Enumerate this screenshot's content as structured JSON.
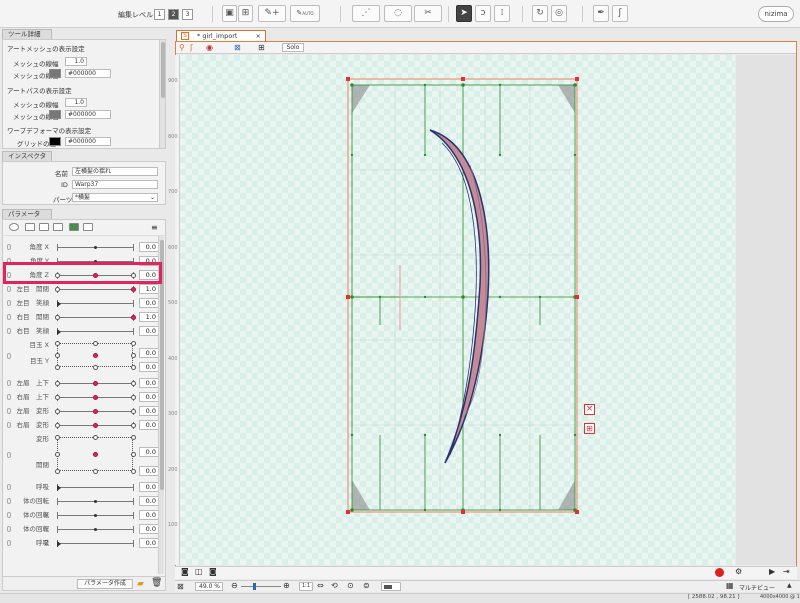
{
  "toolbar": {
    "edit_level_label": "編集レベル：",
    "levels": [
      "1",
      "2",
      "3"
    ],
    "selected_level": "2",
    "tool_labels": [
      "AUTO"
    ],
    "logo_text": "nizima",
    "icons": [
      "deformer-icon",
      "warp-icon",
      "pen-add-icon",
      "auto-mesh-icon",
      "mesh-edit-icon",
      "glue-icon",
      "mesh-cut-icon",
      "select-arrow-icon",
      "lasso-icon",
      "brush-icon",
      "rotate-icon",
      "scale-icon",
      "pen-icon",
      "hook-icon"
    ]
  },
  "tool_details": {
    "tab": "ツール詳細",
    "artmesh_header": "アートメッシュの表示設定",
    "mesh_width_label": "メッシュの線幅",
    "mesh_width_value": "1.0",
    "mesh_color_label": "メッシュの線色",
    "mesh_color_value": "#000000",
    "artpath_header": "アートパスの表示設定",
    "path_width_label": "メッシュの線幅",
    "path_width_value": "1.0",
    "path_color_label": "メッシュの線色",
    "path_color_value": "#000000",
    "warp_header": "ワープデフォーマの表示設定",
    "grid_color_label": "グリッドの色",
    "grid_color_value": "#000000"
  },
  "inspector": {
    "tab": "インスペクタ",
    "name_label": "名前",
    "name_value": "左横髪の揺れ",
    "id_label": "ID",
    "id_value": "Warp37",
    "parts_label": "パーツ",
    "parts_value": "*横髪"
  },
  "parameters": {
    "tab": "パラメータ",
    "rows": [
      {
        "name": "角度 X",
        "value": "0.0",
        "knob": 0.5,
        "style": "dot"
      },
      {
        "name": "角度 Y",
        "value": "0.0",
        "knob": 0.5,
        "style": "dot"
      },
      {
        "name": "角度 Z",
        "value": "0.0",
        "knob": 0.5,
        "style": "keys3"
      },
      {
        "name": "左目　開閉",
        "value": "1.0",
        "knob": 1.0,
        "style": "keys2"
      },
      {
        "name": "左目　笑顔",
        "value": "0.0",
        "knob": 0.0,
        "style": "tri"
      },
      {
        "name": "右目　開閉",
        "value": "1.0",
        "knob": 1.0,
        "style": "keys2"
      },
      {
        "name": "右目　笑顔",
        "value": "0.0",
        "knob": 0.0,
        "style": "tri"
      }
    ],
    "eyeball_x": {
      "name": "目玉 X",
      "value": "0.0"
    },
    "eyeball_y": {
      "name": "目玉 Y",
      "value": "0.0"
    },
    "rows2": [
      {
        "name": "左眉　上下",
        "value": "0.0",
        "knob": 0.5,
        "style": "keys3"
      },
      {
        "name": "右眉　上下",
        "value": "0.0",
        "knob": 0.5,
        "style": "keys3"
      },
      {
        "name": "左眉　変形",
        "value": "0.0",
        "knob": 0.5,
        "style": "keys3"
      },
      {
        "name": "右眉　変形",
        "value": "0.0",
        "knob": 0.5,
        "style": "keys3"
      }
    ],
    "mouth_form": {
      "name": "変形",
      "value": "0.0"
    },
    "mouth_open": {
      "name": "開閉",
      "value": "0.0"
    },
    "rows3": [
      {
        "name": "呼吸",
        "value": "0.0",
        "knob": 0.0,
        "style": "tri"
      },
      {
        "name": "体の回転　X",
        "value": "0.0",
        "knob": 0.5,
        "style": "dot"
      },
      {
        "name": "体の回転　Y",
        "value": "0.0",
        "knob": 0.5,
        "style": "dot"
      },
      {
        "name": "体の回転　Z",
        "value": "0.0",
        "knob": 0.5,
        "style": "dot"
      },
      {
        "name": "呼吸",
        "value": "0.0",
        "knob": 0.0,
        "style": "tri"
      }
    ],
    "create_button": "パラメータ作成"
  },
  "document": {
    "tab_title": "* girl_import",
    "solo_label": "Solo",
    "ruler_ticks": [
      "900",
      "800",
      "700",
      "600",
      "500",
      "400",
      "300",
      "200",
      "100"
    ]
  },
  "status": {
    "zoom": "49.0 %",
    "ratio": "1:1",
    "multiview": "マルチビュー",
    "coords": "[ 2588.02 ,   98.21 ]",
    "footer_text": "4000x4000 @ 1"
  },
  "colors": {
    "highlight": "#e0245e",
    "accent_orange": "#e07030",
    "warp_grid": "#2e8b2e",
    "hair_fill": "#c48a96",
    "hair_outline": "#2a3270"
  }
}
